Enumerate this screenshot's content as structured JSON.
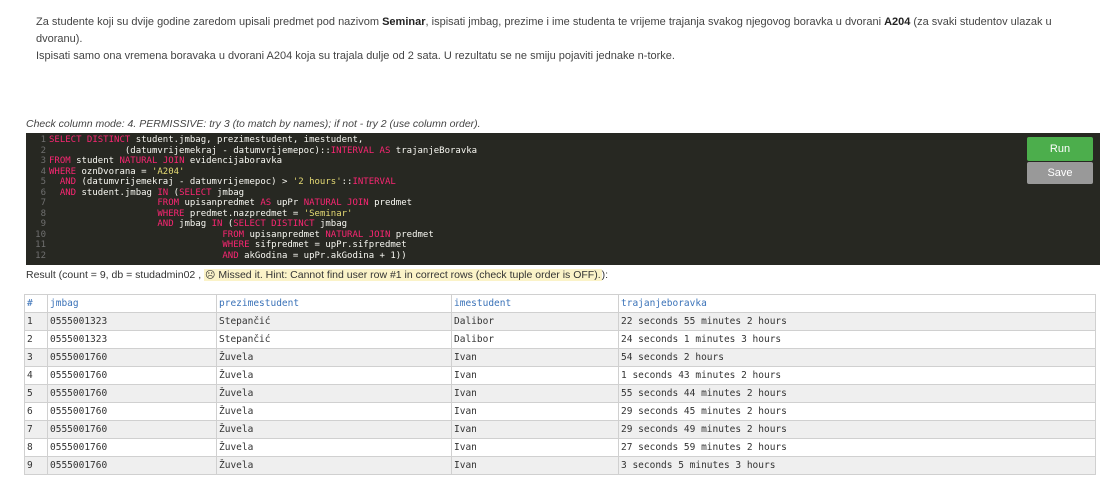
{
  "task": {
    "p1": "Za studente koji su dvije godine zaredom upisali predmet pod nazivom ",
    "b1": "Seminar",
    "p2": ", ispisati jmbag, prezime i ime studenta te vrijeme trajanja svakog njegovog boravka u dvorani ",
    "b2": "A204",
    "p3": " (za svaki studentov ulazak u dvoranu).",
    "line2": "Ispisati samo ona vremena boravaka u dvorani A204 koja su trajala dulje od 2 sata. U rezultatu se ne smiju pojaviti jednake n-torke."
  },
  "mode": "Check column mode: 4. PERMISSIVE: try 3 (to match by names); if not - try 2 (use column order).",
  "editor": {
    "gutter": [
      "1",
      "2",
      "3",
      "4",
      "5",
      "6",
      "7",
      "8",
      "9",
      "10",
      "11",
      "12"
    ],
    "lines": [
      [
        [
          "SELECT DISTINCT",
          "kw"
        ],
        [
          " student.jmbag, prezimestudent, imestudent,",
          ""
        ]
      ],
      [
        [
          "              (datumvrijemekraj - datumvrijemepoc)::",
          ""
        ],
        [
          "INTERVAL",
          "kw"
        ],
        [
          " ",
          ""
        ],
        [
          "AS",
          "kw"
        ],
        [
          " trajanjeBoravka",
          ""
        ]
      ],
      [
        [
          "FROM",
          "kw"
        ],
        [
          " student ",
          ""
        ],
        [
          "NATURAL JOIN",
          "kw"
        ],
        [
          " evidencijaboravka",
          ""
        ]
      ],
      [
        [
          "WHERE",
          "kw"
        ],
        [
          " oznDvorana = ",
          ""
        ],
        [
          "'A204'",
          "st"
        ]
      ],
      [
        [
          "  AND",
          "kw"
        ],
        [
          " (datumvrijemekraj - datumvrijemepoc) > ",
          ""
        ],
        [
          "'2 hours'",
          "st"
        ],
        [
          "::",
          ""
        ],
        [
          "INTERVAL",
          "kw"
        ]
      ],
      [
        [
          "  AND",
          "kw"
        ],
        [
          " student.jmbag ",
          ""
        ],
        [
          "IN",
          "kw"
        ],
        [
          " (",
          ""
        ],
        [
          "SELECT",
          "kw"
        ],
        [
          " jmbag",
          ""
        ]
      ],
      [
        [
          "                    FROM",
          "kw"
        ],
        [
          " upisanpredmet ",
          ""
        ],
        [
          "AS",
          "kw"
        ],
        [
          " upPr ",
          ""
        ],
        [
          "NATURAL JOIN",
          "kw"
        ],
        [
          " predmet",
          ""
        ]
      ],
      [
        [
          "                    WHERE",
          "kw"
        ],
        [
          " predmet.nazpredmet = ",
          ""
        ],
        [
          "'Seminar'",
          "st"
        ]
      ],
      [
        [
          "                    AND",
          "kw"
        ],
        [
          " jmbag ",
          ""
        ],
        [
          "IN",
          "kw"
        ],
        [
          " (",
          ""
        ],
        [
          "SELECT DISTINCT",
          "kw"
        ],
        [
          " jmbag",
          ""
        ]
      ],
      [
        [
          "                                FROM",
          "kw"
        ],
        [
          " upisanpredmet ",
          ""
        ],
        [
          "NATURAL JOIN",
          "kw"
        ],
        [
          " predmet",
          ""
        ]
      ],
      [
        [
          "                                WHERE",
          "kw"
        ],
        [
          " sifpredmet = upPr.sifpredmet",
          ""
        ]
      ],
      [
        [
          "                                AND",
          "kw"
        ],
        [
          " akGodina = upPr.akGodina + 1))",
          ""
        ]
      ]
    ]
  },
  "buttons": {
    "run": "Run",
    "save": "Save"
  },
  "result": {
    "prefix": "Result (count = 9, db = studadmin02 ,",
    "smiley": "☹",
    "hint": "Missed it. Hint: Cannot find user row #1 in correct rows (check tuple order is OFF).",
    "suffix": "):"
  },
  "table": {
    "headers": [
      "#",
      "jmbag",
      "prezimestudent",
      "imestudent",
      "trajanjeboravka"
    ],
    "rows": [
      [
        "1",
        "0555001323",
        "Stepančić",
        "Dalibor",
        "22 seconds 55 minutes 2 hours"
      ],
      [
        "2",
        "0555001323",
        "Stepančić",
        "Dalibor",
        "24 seconds 1 minutes 3 hours"
      ],
      [
        "3",
        "0555001760",
        "Žuvela",
        "Ivan",
        "54 seconds 2 hours"
      ],
      [
        "4",
        "0555001760",
        "Žuvela",
        "Ivan",
        "1 seconds 43 minutes 2 hours"
      ],
      [
        "5",
        "0555001760",
        "Žuvela",
        "Ivan",
        "55 seconds 44 minutes 2 hours"
      ],
      [
        "6",
        "0555001760",
        "Žuvela",
        "Ivan",
        "29 seconds 45 minutes 2 hours"
      ],
      [
        "7",
        "0555001760",
        "Žuvela",
        "Ivan",
        "29 seconds 49 minutes 2 hours"
      ],
      [
        "8",
        "0555001760",
        "Žuvela",
        "Ivan",
        "27 seconds 59 minutes 2 hours"
      ],
      [
        "9",
        "0555001760",
        "Žuvela",
        "Ivan",
        "3 seconds 5 minutes 3 hours"
      ]
    ]
  }
}
